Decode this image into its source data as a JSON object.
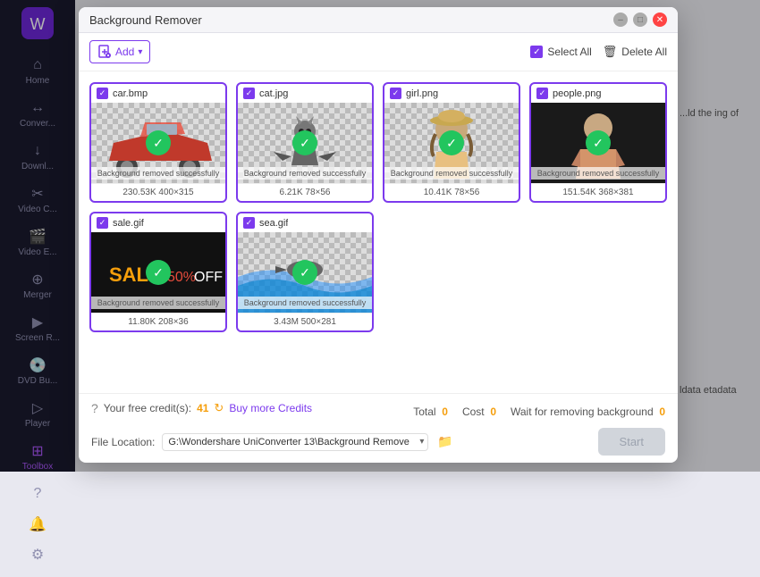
{
  "app": {
    "title": "Background Remover"
  },
  "sidebar": {
    "logo_icon": "🟣",
    "items": [
      {
        "label": "Home",
        "icon": "⌂",
        "active": false
      },
      {
        "label": "Conver...",
        "icon": "↔",
        "active": false
      },
      {
        "label": "Downl...",
        "icon": "↓",
        "active": false
      },
      {
        "label": "Video C...",
        "icon": "✂",
        "active": false
      },
      {
        "label": "Video E...",
        "icon": "🎬",
        "active": false
      },
      {
        "label": "Merger",
        "icon": "⊕",
        "active": false
      },
      {
        "label": "Screen R...",
        "icon": "▶",
        "active": false
      },
      {
        "label": "DVD Bu...",
        "icon": "💿",
        "active": false
      },
      {
        "label": "Player",
        "icon": "▷",
        "active": false
      },
      {
        "label": "Toolbox",
        "icon": "⊞",
        "active": true
      }
    ],
    "bottom": [
      {
        "label": "",
        "icon": "?"
      },
      {
        "label": "",
        "icon": "🔔"
      },
      {
        "label": "",
        "icon": "⚙"
      }
    ]
  },
  "modal": {
    "title": "Background Remover",
    "add_button": "Add",
    "select_all": "Select All",
    "delete_all": "Delete All",
    "images": [
      {
        "filename": "car.bmp",
        "meta": "230.53K  400×315",
        "type": "car",
        "success_msg": "Background removed successfully"
      },
      {
        "filename": "cat.jpg",
        "meta": "6.21K  78×56",
        "type": "cat",
        "success_msg": "Background removed successfully"
      },
      {
        "filename": "girl.png",
        "meta": "10.41K  78×56",
        "type": "girl",
        "success_msg": "Background removed successfully"
      },
      {
        "filename": "people.png",
        "meta": "151.54K  368×381",
        "type": "people",
        "success_msg": "Background removed successfully"
      },
      {
        "filename": "sale.gif",
        "meta": "11.80K  208×36",
        "type": "sale",
        "success_msg": "Background removed successfully"
      },
      {
        "filename": "sea.gif",
        "meta": "3.43M  500×281",
        "type": "sea",
        "success_msg": "Background removed successfully"
      }
    ],
    "footer": {
      "credits_label": "Your free credit(s):",
      "credits_count": "41",
      "buy_link": "Buy more Credits",
      "total_label": "Total",
      "total_val": "0",
      "cost_label": "Cost",
      "cost_val": "0",
      "wait_label": "Wait for removing background",
      "wait_val": "0",
      "location_label": "File Location:",
      "path_value": "G:\\Wondershare UniConverter 13\\Background Remove",
      "start_button": "Start"
    }
  },
  "bg_right1": "...ld the\ning of",
  "bg_right2": "ldata\netadata"
}
